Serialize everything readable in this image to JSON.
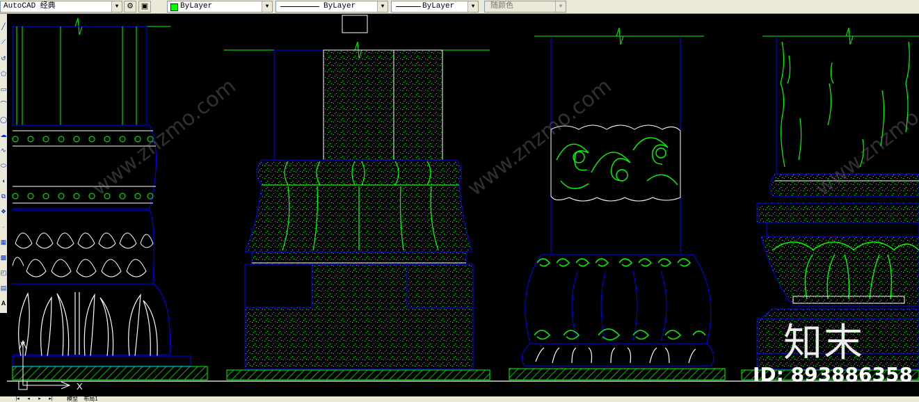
{
  "toolbar": {
    "workspace": "AutoCAD 经典",
    "layer_color_value": "ByLayer",
    "linetype_value": "ByLayer",
    "lineweight_value": "ByLayer",
    "plotstyle_value": "随颜色"
  },
  "statusbar": {
    "model_tab": "模型",
    "layout_tab": "布局1"
  },
  "ucs": {
    "x_label": "X",
    "y_label": "Y"
  },
  "watermark": {
    "logo": "知末",
    "id": "ID: 893886358",
    "diagonal_text": "www.znzmo.com"
  },
  "colors": {
    "background": "#000000",
    "outline": "#0000ff",
    "detail": "#00ff00",
    "white_line": "#ffffff",
    "ui_face": "#ece9d8"
  },
  "icons": [
    "dropdown-arrow-icon",
    "settings-gear-icon",
    "workspace-save-icon",
    "line-icon",
    "circle-icon",
    "arc-icon",
    "text-icon"
  ]
}
